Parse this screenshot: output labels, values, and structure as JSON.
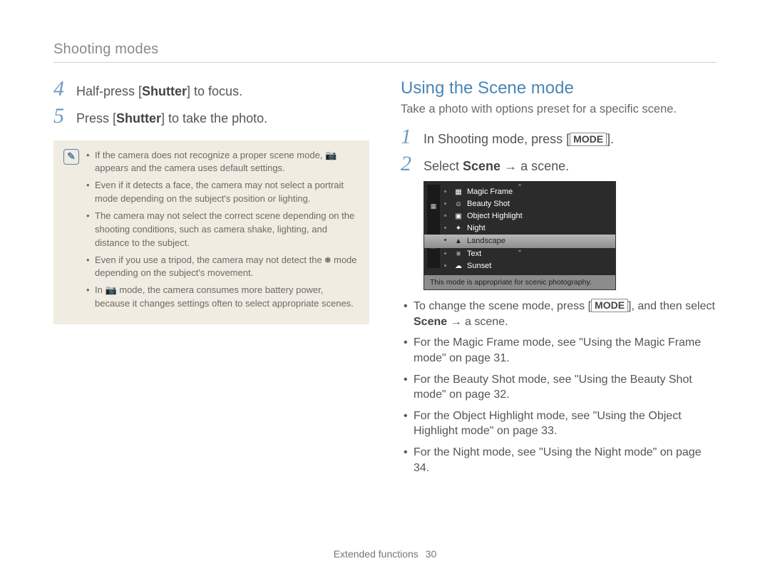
{
  "header": "Shooting modes",
  "left": {
    "steps": [
      {
        "num": "4",
        "pre": "Half-press [",
        "bold": "Shutter",
        "post": "] to focus."
      },
      {
        "num": "5",
        "pre": "Press [",
        "bold": "Shutter",
        "post": "] to take the photo."
      }
    ],
    "notes": [
      "If the camera does not recognize a proper scene mode, 📷 appears and the camera uses default settings.",
      "Even if it detects a face, the camera may not select a portrait mode depending on the subject's position or lighting.",
      "The camera may not select the correct scene depending on the shooting conditions, such as camera shake, lighting, and distance to the subject.",
      "Even if you use a tripod, the camera may not detect the 🞾 mode depending on the subject's movement.",
      "In 📷 mode, the camera consumes more battery power, because it changes settings often to select appropriate scenes."
    ]
  },
  "right": {
    "title": "Using the Scene mode",
    "intro": "Take a photo with options preset for a specific scene.",
    "steps": [
      {
        "num": "1",
        "parts": [
          "In Shooting mode, press [",
          "MODE_PILL",
          "]."
        ]
      },
      {
        "num": "2",
        "parts": [
          "Select ",
          "BOLD:Scene",
          " → a scene."
        ]
      }
    ],
    "scene_menu": {
      "items": [
        {
          "icon": "▦",
          "label": "Magic Frame",
          "selected": false
        },
        {
          "icon": "☺",
          "label": "Beauty Shot",
          "selected": false
        },
        {
          "icon": "▣",
          "label": "Object Highlight",
          "selected": false
        },
        {
          "icon": "✦",
          "label": "Night",
          "selected": false
        },
        {
          "icon": "▲",
          "label": "Landscape",
          "selected": true
        },
        {
          "icon": "≡",
          "label": "Text",
          "selected": false
        },
        {
          "icon": "☁",
          "label": "Sunset",
          "selected": false
        }
      ],
      "description": "This mode is appropriate for scenic photography.",
      "strip_icons": [
        "▦",
        "🎬"
      ]
    },
    "follow_bullets": [
      {
        "segments": [
          "To change the scene mode, press [",
          "MODE_PILL",
          "], and then select ",
          "BOLD:Scene",
          " → a scene."
        ]
      },
      {
        "segments": [
          "For the Magic Frame mode, see \"Using the Magic Frame mode\" on page 31."
        ]
      },
      {
        "segments": [
          "For the Beauty Shot mode, see \"Using the Beauty Shot mode\" on page 32."
        ]
      },
      {
        "segments": [
          "For the Object Highlight mode, see \"Using the Object Highlight mode\" on page 33."
        ]
      },
      {
        "segments": [
          "For the Night mode, see \"Using the Night mode\" on page 34."
        ]
      }
    ],
    "mode_label": "MODE"
  },
  "footer": {
    "section": "Extended functions",
    "page": "30"
  }
}
